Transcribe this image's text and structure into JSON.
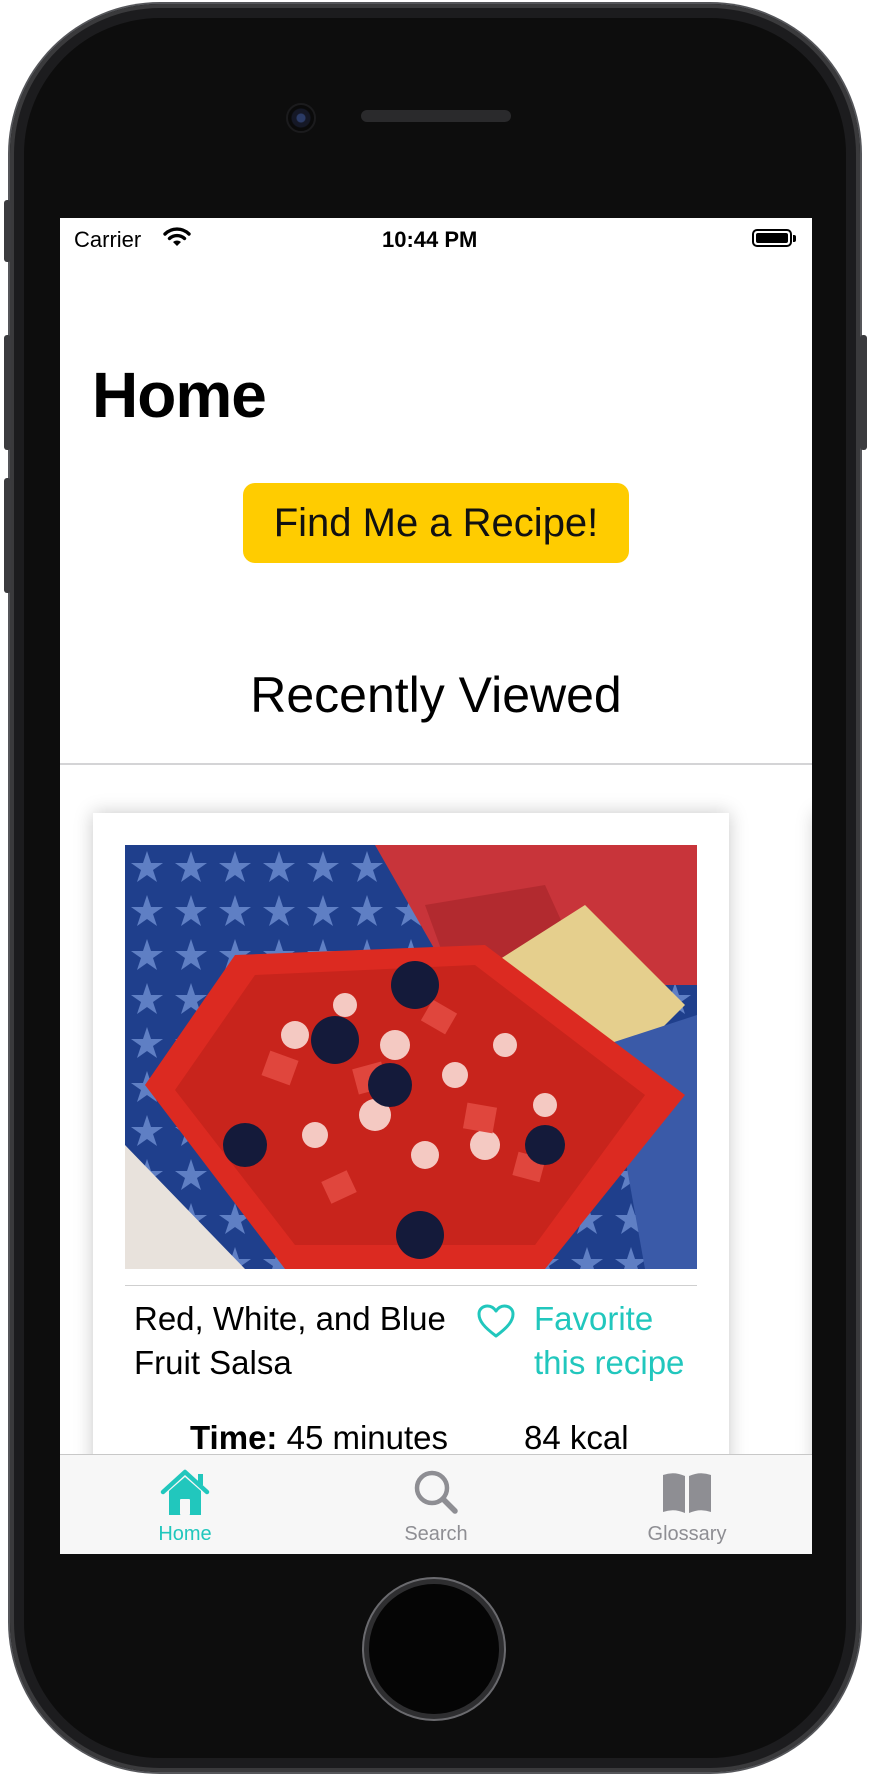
{
  "status_bar": {
    "carrier": "Carrier",
    "time": "10:44 PM"
  },
  "page": {
    "title": "Home",
    "find_button_label": "Find Me a Recipe!",
    "section_title": "Recently Viewed"
  },
  "recent_recipes": [
    {
      "name": "Red, White, and Blue Fruit Salsa",
      "favorite_label": "Favorite this recipe",
      "time_label": "Time:",
      "time_value": "45 minutes",
      "calories": "84 kcal"
    }
  ],
  "tab_bar": {
    "tabs": [
      {
        "label": "Home",
        "icon": "house-icon",
        "active": true
      },
      {
        "label": "Search",
        "icon": "magnifier-icon",
        "active": false
      },
      {
        "label": "Glossary",
        "icon": "book-icon",
        "active": false
      }
    ]
  },
  "colors": {
    "accent": "#21c7bd",
    "button": "#ffcc00"
  }
}
